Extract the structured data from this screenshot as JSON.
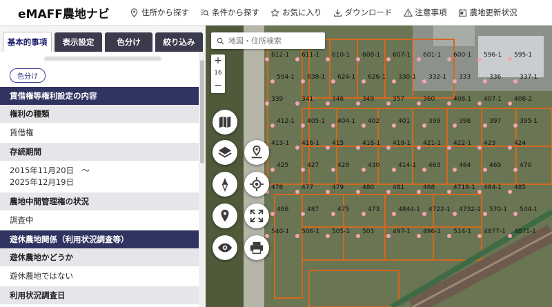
{
  "app": {
    "title": "eMAFF農地ナビ"
  },
  "nav": [
    {
      "label": "住所から探す",
      "icon": "location-pin-icon"
    },
    {
      "label": "条件から探す",
      "icon": "filter-search-icon"
    },
    {
      "label": "お気に入り",
      "icon": "star-icon"
    },
    {
      "label": "ダウンロード",
      "icon": "download-icon"
    },
    {
      "label": "注意事項",
      "icon": "warning-icon"
    },
    {
      "label": "農地更新状況",
      "icon": "calendar-icon"
    }
  ],
  "sidebar": {
    "tabs": [
      "基本的事項",
      "表示設定",
      "色分け",
      "絞り込み"
    ],
    "color_button": "色分け",
    "sections": {
      "lease_title": "賃借権等権利設定の内容",
      "right_type_label": "権利の種類",
      "right_type_value": "賃借権",
      "period_label": "存続期間",
      "period_value_1": "2015年11月20日　～",
      "period_value_2": "2025年12月19日",
      "agency_label": "農地中間管理権の状況",
      "agency_value": "調査中",
      "idle_title": "遊休農地関係（利用状況調査等）",
      "idle_label": "遊休農地かどうか",
      "idle_value": "遊休農地ではない",
      "survey_label": "利用状況調査日"
    }
  },
  "map": {
    "search_placeholder": "地図・住所検索",
    "zoom_in": "+",
    "zoom_level": "16",
    "zoom_out": "−",
    "parcels": [
      "612-1",
      "611-1",
      "610-1",
      "608-1",
      "607-1",
      "601-1",
      "600-1",
      "596-1",
      "595-1",
      "594-1",
      "638-1",
      "624-1",
      "626-1",
      "330-1",
      "332-1",
      "333",
      "336",
      "337-1",
      "339",
      "341",
      "346",
      "349",
      "357",
      "360",
      "408-1",
      "407-1",
      "408-2",
      "412-1",
      "405-1",
      "404-1",
      "402",
      "401",
      "399",
      "398",
      "397",
      "395-1",
      "413-1",
      "416-1",
      "415",
      "418-1",
      "419-1",
      "421-1",
      "422-1",
      "423",
      "424",
      "425",
      "427",
      "428",
      "430",
      "414-1",
      "463",
      "464",
      "469",
      "470",
      "476",
      "477",
      "479",
      "480",
      "481",
      "468",
      "4718-1",
      "484-1",
      "485",
      "486",
      "487",
      "475",
      "473",
      "4844-1",
      "4722-1",
      "4732-1",
      "570-1",
      "544-1",
      "540-1",
      "506-1",
      "505-1",
      "503",
      "497-1",
      "496-1",
      "514-1",
      "4877-1",
      "4871-1"
    ]
  }
}
